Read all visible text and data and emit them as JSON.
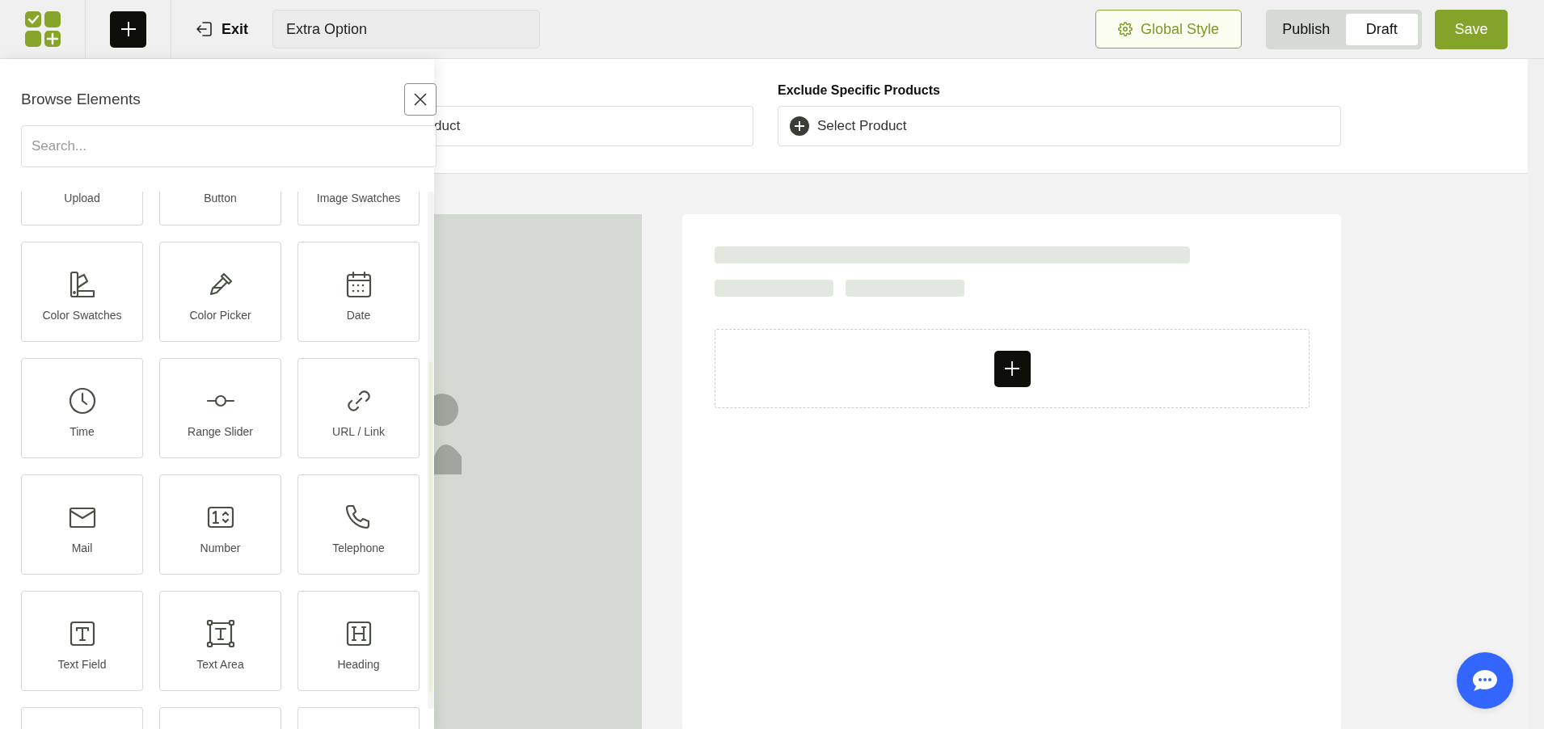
{
  "toolbar": {
    "exit_label": "Exit",
    "form_name": "Extra Option",
    "global_style": "Global Style",
    "status_options": [
      {
        "label": "Publish",
        "selected": false
      },
      {
        "label": "Draft",
        "selected": true
      }
    ],
    "save": "Save"
  },
  "panel": {
    "title": "Browse Elements",
    "search": {
      "placeholder": "Search..."
    },
    "elements": [
      {
        "label": "Upload",
        "kind": "none",
        "cut_top": true,
        "cut_bottom": false
      },
      {
        "label": "Button",
        "kind": "none",
        "cut_top": true,
        "cut_bottom": false
      },
      {
        "label": "Image Swatches",
        "kind": "none",
        "cut_top": true,
        "cut_bottom": false
      },
      {
        "label": "Color Swatches",
        "kind": "swatches",
        "cut_top": false,
        "cut_bottom": false
      },
      {
        "label": "Color Picker",
        "kind": "picker",
        "cut_top": false,
        "cut_bottom": false
      },
      {
        "label": "Date",
        "kind": "date",
        "cut_top": false,
        "cut_bottom": false
      },
      {
        "label": "Time",
        "kind": "time",
        "cut_top": false,
        "cut_bottom": false
      },
      {
        "label": "Range Slider",
        "kind": "slider",
        "cut_top": false,
        "cut_bottom": false
      },
      {
        "label": "URL / Link",
        "kind": "link",
        "cut_top": false,
        "cut_bottom": false
      },
      {
        "label": "Mail",
        "kind": "mail",
        "cut_top": false,
        "cut_bottom": false
      },
      {
        "label": "Number",
        "kind": "number",
        "cut_top": false,
        "cut_bottom": false
      },
      {
        "label": "Telephone",
        "kind": "phone",
        "cut_top": false,
        "cut_bottom": false
      },
      {
        "label": "Text Field",
        "kind": "textfield",
        "cut_top": false,
        "cut_bottom": false
      },
      {
        "label": "Text Area",
        "kind": "textarea",
        "cut_top": false,
        "cut_bottom": false
      },
      {
        "label": "Heading",
        "kind": "heading",
        "cut_top": false,
        "cut_bottom": false
      },
      {
        "kind": "none",
        "cut_top": false,
        "cut_bottom": true
      },
      {
        "kind": "none",
        "cut_top": false,
        "cut_bottom": true
      },
      {
        "kind": "none",
        "cut_top": false,
        "cut_bottom": true
      }
    ]
  },
  "product_fields": [
    {
      "value": "duct"
    },
    {
      "label": "Exclude Specific Products",
      "value": "Select Product"
    }
  ]
}
